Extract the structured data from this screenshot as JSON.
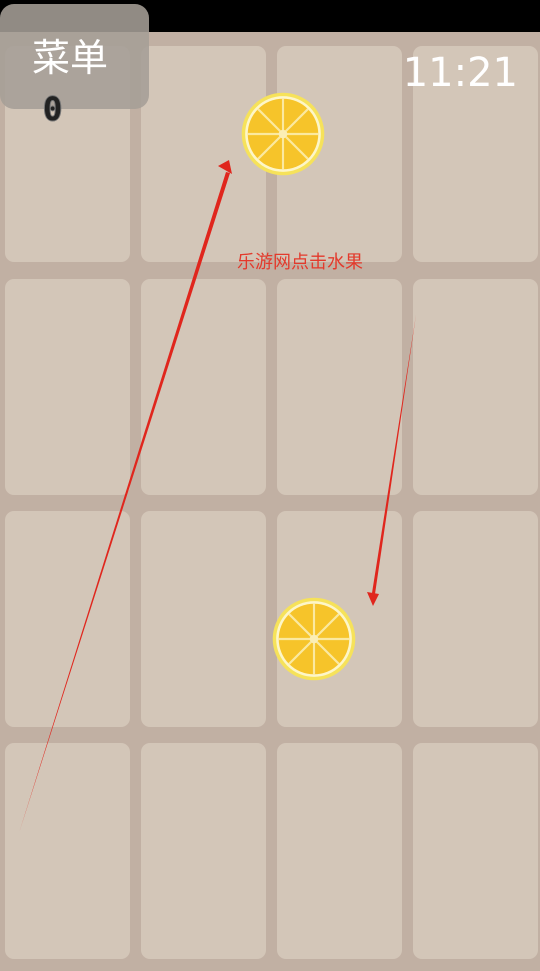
{
  "menu": {
    "label": "菜单"
  },
  "score": "0",
  "timer": "11:21",
  "watermark": "乐游网点击水果",
  "grid": {
    "rows": 4,
    "cols": 4
  },
  "fruits": [
    {
      "kind": "lemon-slice",
      "row": 1,
      "col": 2
    },
    {
      "kind": "lemon-slice",
      "row": 3,
      "col": 2
    }
  ],
  "colors": {
    "board_background": "#c1b0a3",
    "tile": "#d3c6b8",
    "status_bar": "#000000",
    "lemon_rind": "#f6e25a",
    "lemon_flesh": "#f6c42a",
    "annotation_arrow": "#e0261d"
  }
}
